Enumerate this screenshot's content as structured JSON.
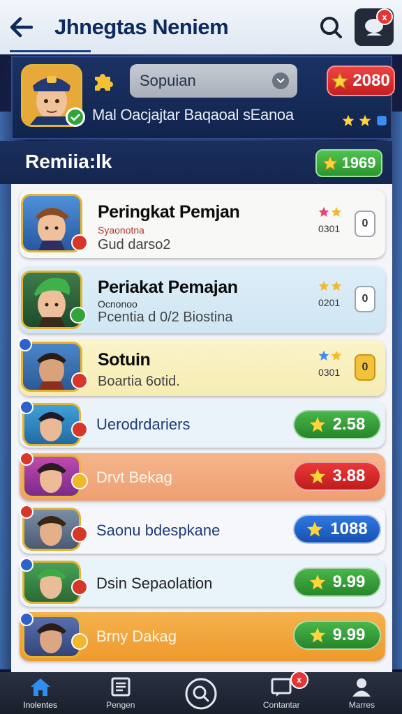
{
  "header": {
    "title": "Jhnegtas Neniem",
    "notification_count": "x"
  },
  "profile": {
    "search_value": "Sopuian",
    "coins": "2080",
    "subtitle": "Mal Oacjajtar Baqaoal sEanoa"
  },
  "ranking": {
    "title": "Remiia:lk",
    "total": "1969"
  },
  "rows": [
    {
      "name": "Peringkat Pemjan",
      "sub_red": "Syaonotna",
      "sub": "Gud darso2",
      "num": "0301",
      "lock": "0"
    },
    {
      "name": "Periakat Pemajan",
      "sub_red": "Ocnonoo",
      "sub": "Pcentia d 0/2 Biostina",
      "num": "0201",
      "lock": "0"
    },
    {
      "name": "Sotuin",
      "sub": "Boartia 6otid.",
      "num": "0301",
      "lock": "0"
    },
    {
      "name": "Uerodrdariers",
      "score": "2.58",
      "color": "#2e9a2e"
    },
    {
      "name": "Drvt Bekag",
      "score": "3.88",
      "color": "#d62626"
    },
    {
      "name": "Saonu bdespkane",
      "score": "1088",
      "color": "#1e63c9"
    },
    {
      "name": "Dsin Sepaolation",
      "score": "9.99",
      "color": "#2e9a2e"
    },
    {
      "name": "Brny Dakag",
      "score": "9.99",
      "color": "#2e9a2e"
    }
  ],
  "nav": [
    {
      "label": "Inolentes",
      "icon": "home-icon"
    },
    {
      "label": "Pengen",
      "icon": "cards-icon"
    },
    {
      "label": "",
      "icon": "search-icon"
    },
    {
      "label": "Contantar",
      "icon": "chat-icon"
    },
    {
      "label": "Marres",
      "icon": "profile-icon"
    }
  ]
}
